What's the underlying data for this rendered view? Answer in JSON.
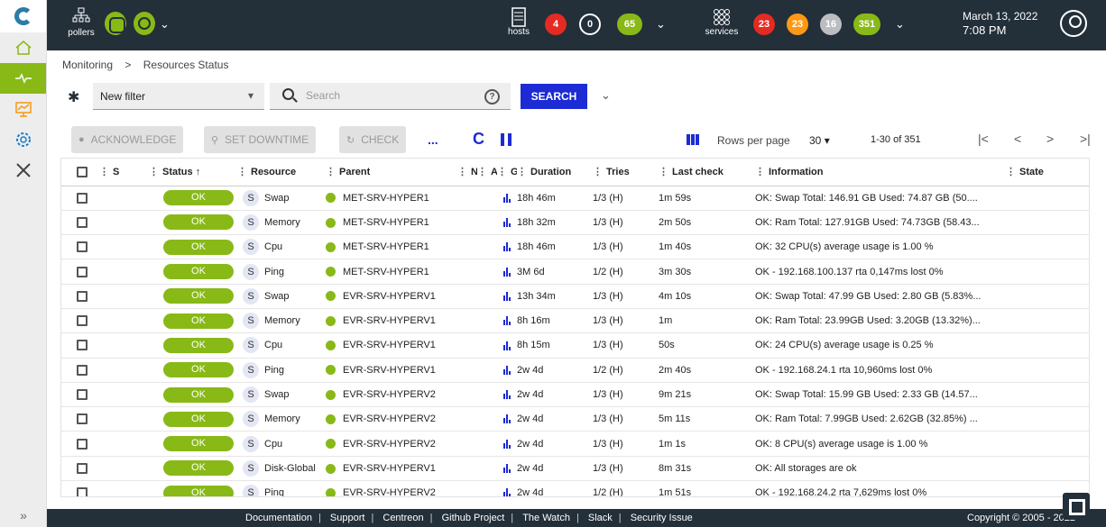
{
  "header": {
    "pollers_label": "pollers",
    "hosts_label": "hosts",
    "hosts_counts": [
      "4",
      "0",
      "65"
    ],
    "services_label": "services",
    "services_counts": [
      "23",
      "23",
      "16",
      "351"
    ],
    "date": "March 13, 2022",
    "time": "7:08 PM"
  },
  "breadcrumb": [
    "Monitoring",
    ">",
    "Resources Status"
  ],
  "filter": {
    "selected": "New filter",
    "search_placeholder": "Search",
    "search_button": "SEARCH"
  },
  "actions": {
    "acknowledge": "ACKNOWLEDGE",
    "set_downtime": "SET DOWNTIME",
    "check": "CHECK",
    "more": "...",
    "rows_per_page_label": "Rows per page",
    "rows_per_page_value": "30",
    "range": "1-30 of 351"
  },
  "table": {
    "columns": [
      "S",
      "Status",
      "Resource",
      "Parent",
      "N",
      "A",
      "G",
      "Duration",
      "Tries",
      "Last check",
      "Information",
      "State"
    ],
    "rows": [
      {
        "status": "OK",
        "type": "S",
        "resource": "Swap",
        "parent": "MET-SRV-HYPER1",
        "duration": "18h 46m",
        "tries": "1/3 (H)",
        "last_check": "1m 59s",
        "info": "OK: Swap Total: 146.91 GB Used: 74.87 GB (50...."
      },
      {
        "status": "OK",
        "type": "S",
        "resource": "Memory",
        "parent": "MET-SRV-HYPER1",
        "duration": "18h 32m",
        "tries": "1/3 (H)",
        "last_check": "2m 50s",
        "info": "OK: Ram Total: 127.91GB Used: 74.73GB (58.43..."
      },
      {
        "status": "OK",
        "type": "S",
        "resource": "Cpu",
        "parent": "MET-SRV-HYPER1",
        "duration": "18h 46m",
        "tries": "1/3 (H)",
        "last_check": "1m 40s",
        "info": "OK: 32 CPU(s) average usage is 1.00 %"
      },
      {
        "status": "OK",
        "type": "S",
        "resource": "Ping",
        "parent": "MET-SRV-HYPER1",
        "duration": "3M 6d",
        "tries": "1/2 (H)",
        "last_check": "3m 30s",
        "info": "OK - 192.168.100.137 rta 0,147ms lost 0%"
      },
      {
        "status": "OK",
        "type": "S",
        "resource": "Swap",
        "parent": "EVR-SRV-HYPERV1",
        "duration": "13h 34m",
        "tries": "1/3 (H)",
        "last_check": "4m 10s",
        "info": "OK: Swap Total: 47.99 GB Used: 2.80 GB (5.83%..."
      },
      {
        "status": "OK",
        "type": "S",
        "resource": "Memory",
        "parent": "EVR-SRV-HYPERV1",
        "duration": "8h 16m",
        "tries": "1/3 (H)",
        "last_check": "1m",
        "info": "OK: Ram Total: 23.99GB Used: 3.20GB (13.32%)..."
      },
      {
        "status": "OK",
        "type": "S",
        "resource": "Cpu",
        "parent": "EVR-SRV-HYPERV1",
        "duration": "8h 15m",
        "tries": "1/3 (H)",
        "last_check": "50s",
        "info": "OK: 24 CPU(s) average usage is 0.25 %"
      },
      {
        "status": "OK",
        "type": "S",
        "resource": "Ping",
        "parent": "EVR-SRV-HYPERV1",
        "duration": "2w 4d",
        "tries": "1/2 (H)",
        "last_check": "2m 40s",
        "info": "OK - 192.168.24.1 rta 10,960ms lost 0%"
      },
      {
        "status": "OK",
        "type": "S",
        "resource": "Swap",
        "parent": "EVR-SRV-HYPERV2",
        "duration": "2w 4d",
        "tries": "1/3 (H)",
        "last_check": "9m 21s",
        "info": "OK: Swap Total: 15.99 GB Used: 2.33 GB (14.57..."
      },
      {
        "status": "OK",
        "type": "S",
        "resource": "Memory",
        "parent": "EVR-SRV-HYPERV2",
        "duration": "2w 4d",
        "tries": "1/3 (H)",
        "last_check": "5m 11s",
        "info": "OK: Ram Total: 7.99GB Used: 2.62GB (32.85%) ..."
      },
      {
        "status": "OK",
        "type": "S",
        "resource": "Cpu",
        "parent": "EVR-SRV-HYPERV2",
        "duration": "2w 4d",
        "tries": "1/3 (H)",
        "last_check": "1m 1s",
        "info": "OK: 8 CPU(s) average usage is 1.00 %"
      },
      {
        "status": "OK",
        "type": "S",
        "resource": "Disk-Global",
        "parent": "EVR-SRV-HYPERV1",
        "duration": "2w 4d",
        "tries": "1/3 (H)",
        "last_check": "8m 31s",
        "info": "OK: All storages are ok"
      },
      {
        "status": "OK",
        "type": "S",
        "resource": "Ping",
        "parent": "EVR-SRV-HYPERV2",
        "duration": "2w 4d",
        "tries": "1/2 (H)",
        "last_check": "1m 51s",
        "info": "OK - 192.168.24.2 rta 7,629ms lost 0%"
      }
    ]
  },
  "footer": {
    "links": [
      "Documentation",
      "Support",
      "Centreon",
      "Github Project",
      "The Watch",
      "Slack",
      "Security Issue"
    ],
    "copyright": "Copyright © 2005 - 2022"
  },
  "icons": {
    "left_nav": [
      "home-icon",
      "monitoring-icon",
      "reporting-icon",
      "configuration-icon",
      "administration-icon"
    ]
  },
  "colors": {
    "ok": "#88b917",
    "critical": "#e42b22",
    "warning": "#ff9913",
    "unknown": "#bcbdc0",
    "header_bg": "#232f39",
    "primary": "#1c2bd4"
  }
}
